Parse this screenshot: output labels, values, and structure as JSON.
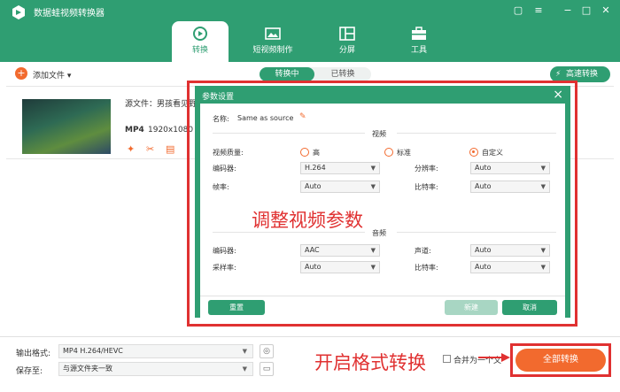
{
  "app": {
    "title": "数据蛙视频转换器"
  },
  "window_controls": {
    "feedback": "▢",
    "menu": "≡",
    "minimize": "−",
    "maximize": "□",
    "close": "✕"
  },
  "tabs": [
    {
      "label": "转换"
    },
    {
      "label": "短视频制作"
    },
    {
      "label": "分屏"
    },
    {
      "label": "工具"
    }
  ],
  "toolbar": {
    "add_file": "添加文件",
    "converting": "转换中",
    "converted": "已转换",
    "fast_convert": "高速转换"
  },
  "file": {
    "source_label": "源文件：男孩看见野",
    "format": "MP4",
    "resolution": "1920x1080"
  },
  "dialog": {
    "title": "参数设置",
    "name_label": "名称:",
    "name_value": "Same as source",
    "video_section": "视频",
    "quality_label": "视频质量:",
    "quality_options": [
      "高",
      "标准",
      "自定义"
    ],
    "quality_selected": "自定义",
    "encoder_label": "编码器:",
    "encoder_value": "H.264",
    "resolution_label": "分辨率:",
    "resolution_value": "Auto",
    "framerate_label": "帧率:",
    "framerate_value": "Auto",
    "bitrate_label": "比特率:",
    "bitrate_value": "Auto",
    "audio_section": "音频",
    "a_encoder_label": "编码器:",
    "a_encoder_value": "AAC",
    "channel_label": "声道:",
    "channel_value": "Auto",
    "samplerate_label": "采样率:",
    "samplerate_value": "Auto",
    "a_bitrate_label": "比特率:",
    "a_bitrate_value": "Auto",
    "reset": "重置",
    "new": "新建",
    "cancel": "取消"
  },
  "bottom": {
    "output_label": "输出格式:",
    "output_value": "MP4 H.264/HEVC",
    "save_label": "保存至:",
    "save_value": "与源文件夹一致",
    "merge": "合并为一个文件",
    "convert_all": "全部转换"
  },
  "annotations": {
    "video_params": "调整视频参数",
    "start_convert": "开启格式转换"
  },
  "colors": {
    "brand": "#2f9e72",
    "accent": "#f26a2e",
    "annotation": "#e03131"
  }
}
